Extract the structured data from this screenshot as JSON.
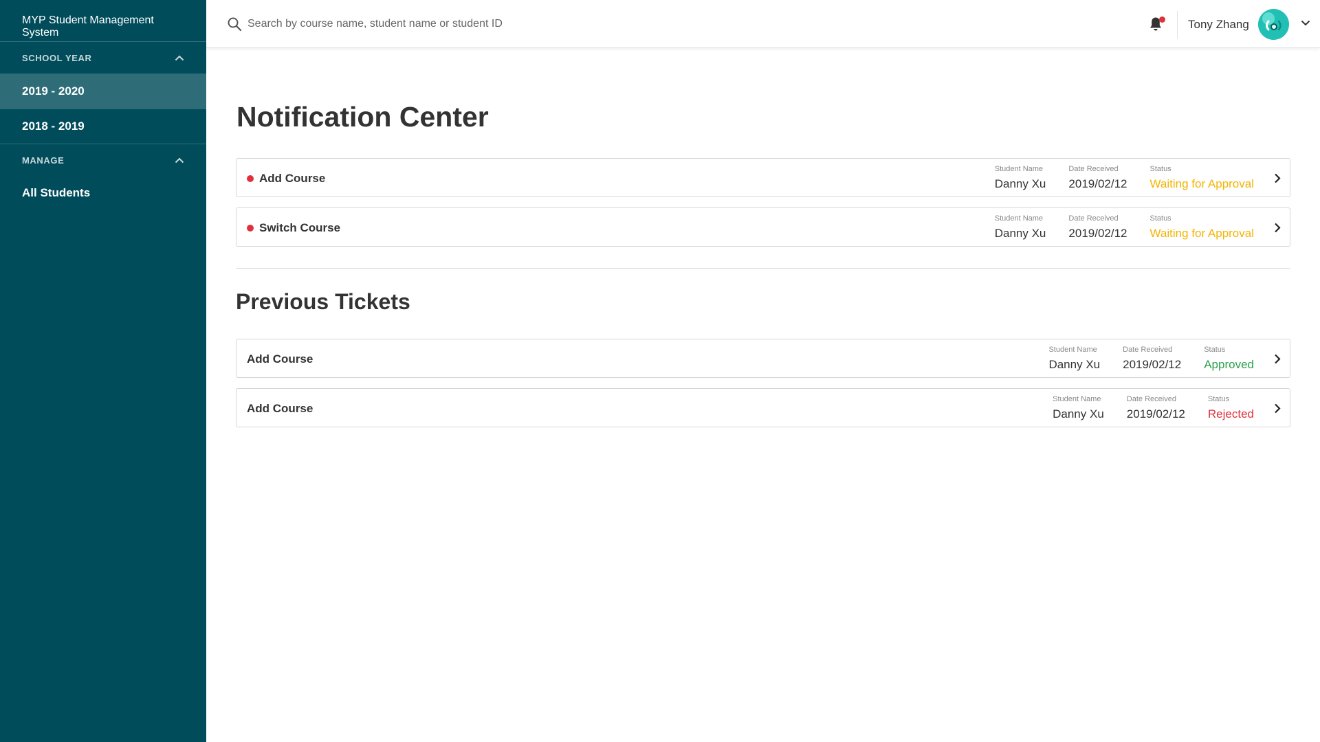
{
  "app": {
    "title": "MYP Student Management System"
  },
  "sidebar": {
    "sections": [
      {
        "label": "SCHOOL YEAR"
      },
      {
        "label": "MANAGE"
      }
    ],
    "items": [
      {
        "label": "2019 - 2020",
        "active": true
      },
      {
        "label": "2018 - 2019",
        "active": false
      },
      {
        "label": "All Students",
        "active": false
      }
    ]
  },
  "header": {
    "search_placeholder": "Search by course name, student name or student ID",
    "user_name": "Tony Zhang",
    "has_notification": true
  },
  "page": {
    "title": "Notification Center",
    "previous_title": "Previous Tickets"
  },
  "labels": {
    "student_name": "Student Name",
    "date_received": "Date Received",
    "status": "Status"
  },
  "colors": {
    "sidebar_bg": "#014c5b",
    "sidebar_active": "#2e6c78",
    "waiting": "#f4b400",
    "approved": "#2aa24a",
    "rejected": "#e0313b",
    "unread_dot": "#e0313b"
  },
  "notifications": [
    {
      "title": "Add Course",
      "student": "Danny Xu",
      "date": "2019/02/12",
      "status": "Waiting for Approval",
      "status_type": "waiting",
      "unread": true
    },
    {
      "title": "Switch Course",
      "student": "Danny Xu",
      "date": "2019/02/12",
      "status": "Waiting for Approval",
      "status_type": "waiting",
      "unread": true
    }
  ],
  "previous_tickets": [
    {
      "title": "Add Course",
      "student": "Danny Xu",
      "date": "2019/02/12",
      "status": "Approved",
      "status_type": "approved"
    },
    {
      "title": "Add Course",
      "student": "Danny Xu",
      "date": "2019/02/12",
      "status": "Rejected",
      "status_type": "rejected"
    }
  ],
  "icons": [
    "chevron-up-icon",
    "search-icon",
    "bell-icon",
    "chevron-down-icon",
    "chevron-right-icon",
    "unread-dot-icon"
  ]
}
